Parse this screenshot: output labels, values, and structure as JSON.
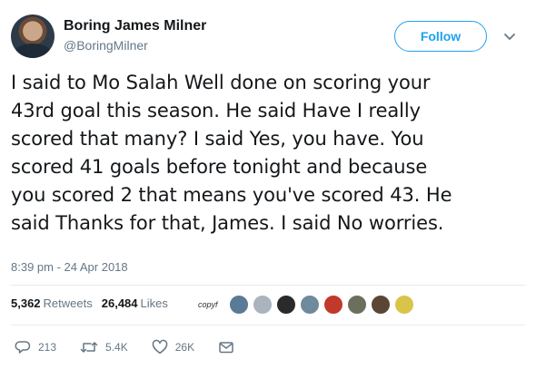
{
  "author": {
    "name": "Boring James Milner",
    "handle": "@BoringMilner"
  },
  "follow_label": "Follow",
  "tweet_lines": [
    "I said to Mo Salah Well done on scoring your",
    "43rd goal this season. He said Have I really",
    "scored that many? I said Yes, you have. You",
    "scored 41 goals before tonight and because",
    "you scored 2 that means you've scored 43. He",
    "said Thanks for that, James. I said No worries."
  ],
  "timestamp": "8:39 pm - 24 Apr 2018",
  "stats": {
    "retweets_count": "5,362",
    "retweets_label": "Retweets",
    "likes_count": "26,484",
    "likes_label": "Likes"
  },
  "liker_avatar_text": "copyf",
  "liker_colors": [
    "#5a7a98",
    "#a9b4bf",
    "#2a2a2a",
    "#6e8a9c",
    "#c0392b",
    "#6b705c",
    "#5b4636",
    "#d9c44a"
  ],
  "actions": {
    "replies": "213",
    "retweets": "5.4K",
    "likes": "26K"
  },
  "icons": [
    "chevron-down-icon",
    "reply-icon",
    "retweet-icon",
    "like-icon",
    "direct-message-icon"
  ],
  "colors": {
    "accent": "#1da1f2",
    "muted": "#657786",
    "text": "#14171a"
  }
}
